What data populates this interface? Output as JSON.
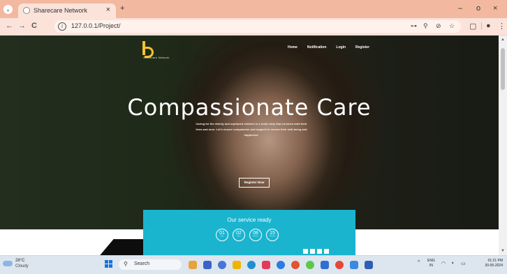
{
  "browser": {
    "tab_title": "Sharecare Network",
    "tab_close": "×",
    "new_tab": "+",
    "window_min": "–",
    "window_max": "o",
    "window_close": "×",
    "back": "←",
    "forward": "→",
    "reload": "C",
    "url": "127.0.0.1/Project/"
  },
  "site": {
    "brand_letter": "S",
    "brand_name": "Sharecare Network",
    "nav": [
      "Home",
      "Notification",
      "Login",
      "Register"
    ],
    "hero_title": "Compassionate Care",
    "hero_text": "Caring for the elderly and orphaned children is a noble duty that enriches both their lives and ours. Let's ensure compassion and support to ensure their well-being and happiness.",
    "cta": "Register Now",
    "service_title": "Our service ready",
    "countdown": [
      {
        "value": "01",
        "label": "Days"
      },
      {
        "value": "02",
        "label": "Hours"
      },
      {
        "value": "08",
        "label": "Minutes"
      },
      {
        "value": "15",
        "label": "Seconds"
      }
    ]
  },
  "taskbar": {
    "temperature": "28°C",
    "weather": "Cloudy",
    "search_placeholder": "Search",
    "lang_top": "ENG",
    "lang_bottom": "IN",
    "time": "01:21 PM",
    "date": "30-05-2024"
  },
  "colors": {
    "accent": "#1ab4cf",
    "brand": "#f2c230",
    "tabbar": "#f2b8a0"
  }
}
